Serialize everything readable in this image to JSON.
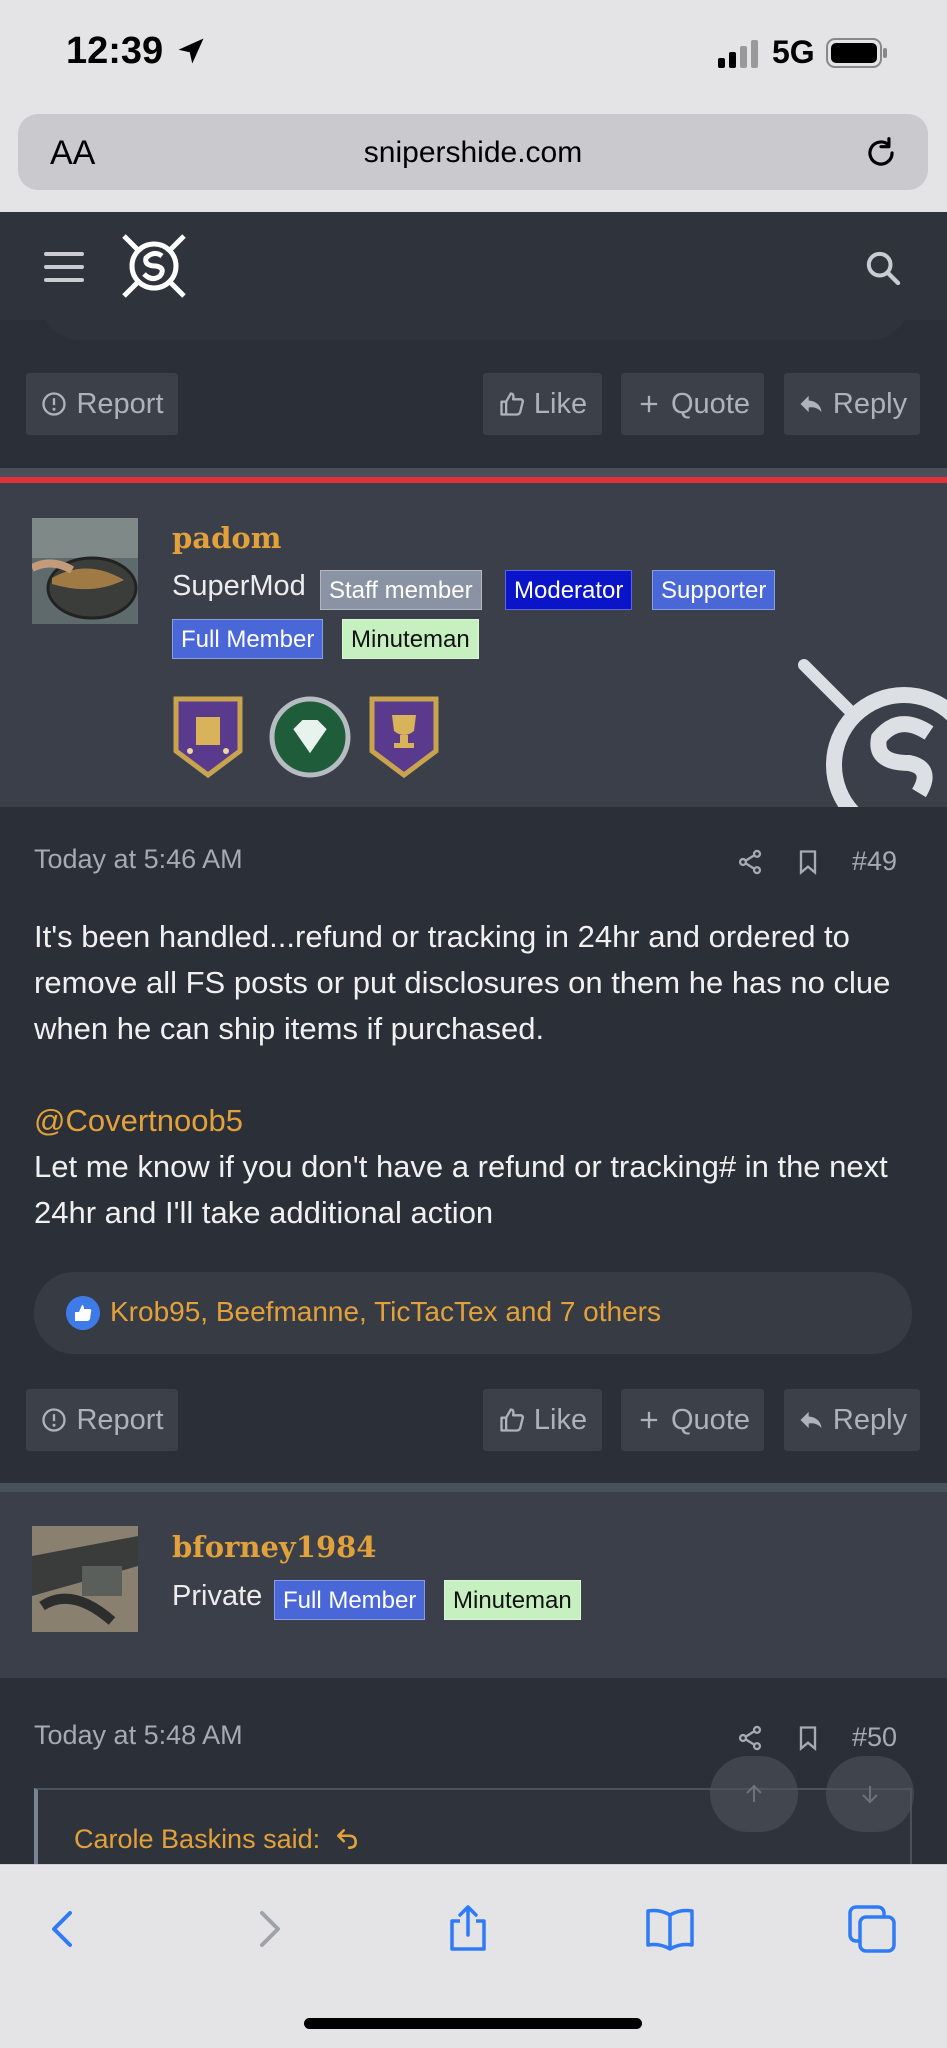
{
  "status_bar": {
    "time": "12:39",
    "network": "5G"
  },
  "browser": {
    "text_size_label": "AA",
    "url": "snipershide.com"
  },
  "buttons": {
    "report": "Report",
    "like": "Like",
    "quote": "Quote",
    "reply": "Reply"
  },
  "posts": [
    {
      "username": "padom",
      "user_title": "SuperMod",
      "badges": [
        "Staff member",
        "Moderator",
        "Supporter",
        "Full Member",
        "Minuteman"
      ],
      "timestamp": "Today at 5:46 AM",
      "number": "#49",
      "body_p1": "It's been handled...refund or tracking in 24hr and ordered to remove all FS posts or put disclosures on them he has no clue when he can ship items if purchased.",
      "mention": "@Covertnoob5",
      "body_p2": "Let me know if you don't have a refund or tracking# in the next 24hr and I'll take additional action",
      "reactions": "Krob95, Beefmanne, TicTacTex and 7 others"
    },
    {
      "username": "bforney1984",
      "user_title": "Private",
      "badges": [
        "Full Member",
        "Minuteman"
      ],
      "timestamp": "Today at 5:48 AM",
      "number": "#50",
      "quote_author": "Carole Baskins said:"
    }
  ],
  "colors": {
    "accent": "#e2a13a",
    "moderator": "#0a14c8",
    "supporter": "#4a67d8",
    "minuteman": "#c7f0c1",
    "red_rule": "#e0323b"
  }
}
